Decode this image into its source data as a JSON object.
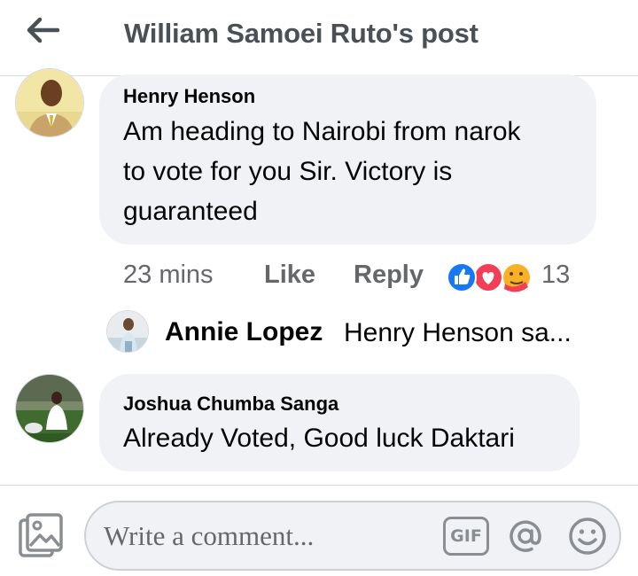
{
  "header": {
    "title": "William Samoei Ruto's post"
  },
  "comments": [
    {
      "author": "Henry Henson",
      "text_lines": [
        "Am heading to Nairobi from narok",
        "to vote for you Sir. Victory is",
        "guaranteed"
      ],
      "time": "23 mins",
      "like_label": "Like",
      "reply_label": "Reply",
      "reaction_count": "13",
      "reactions": [
        "like-reaction-icon",
        "love-reaction-icon",
        "care-reaction-icon"
      ],
      "reply_preview": {
        "author": "Annie Lopez",
        "snippet": "Henry Henson sa..."
      }
    },
    {
      "author": "Joshua Chumba Sanga",
      "text_lines": [
        "Already Voted, Good luck Daktari"
      ]
    }
  ],
  "composer": {
    "placeholder": "Write a comment...",
    "gif_label": "GIF"
  },
  "colors": {
    "bubble": "#f0f2f5",
    "secondary_text": "#65676b",
    "like_blue": "#1877f2",
    "love_red": "#f33e58",
    "care_yellow": "#f7b125"
  }
}
